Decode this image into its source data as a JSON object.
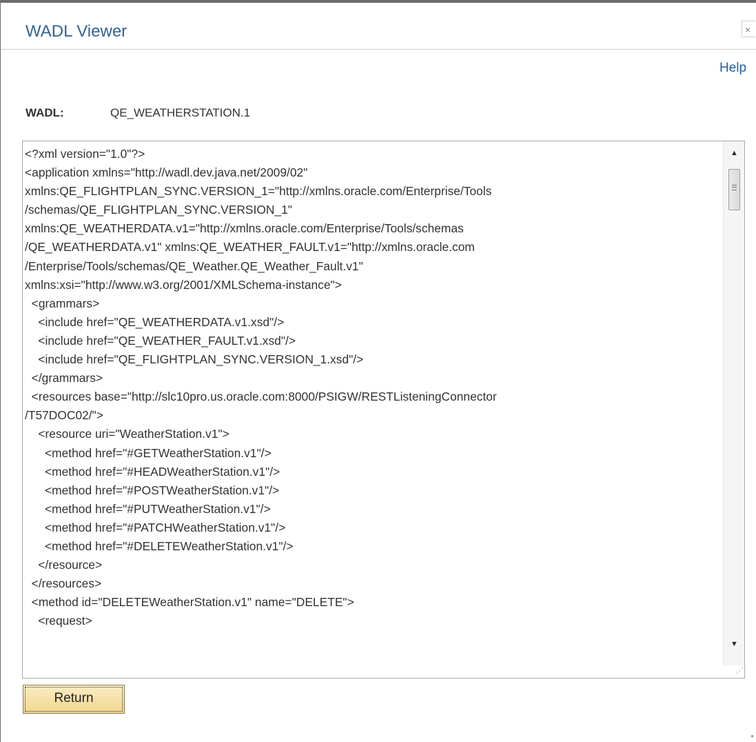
{
  "dialog": {
    "title": "WADL Viewer",
    "close_label": "×",
    "help_label": "Help"
  },
  "wadl": {
    "label": "WADL:",
    "value": "QE_WEATHERSTATION.1"
  },
  "content": {
    "text": "<?xml version=\"1.0\"?>\n<application xmlns=\"http://wadl.dev.java.net/2009/02\"\nxmlns:QE_FLIGHTPLAN_SYNC.VERSION_1=\"http://xmlns.oracle.com/Enterprise/Tools\n/schemas/QE_FLIGHTPLAN_SYNC.VERSION_1\"\nxmlns:QE_WEATHERDATA.v1=\"http://xmlns.oracle.com/Enterprise/Tools/schemas\n/QE_WEATHERDATA.v1\" xmlns:QE_WEATHER_FAULT.v1=\"http://xmlns.oracle.com\n/Enterprise/Tools/schemas/QE_Weather.QE_Weather_Fault.v1\"\nxmlns:xsi=\"http://www.w3.org/2001/XMLSchema-instance\">\n  <grammars>\n    <include href=\"QE_WEATHERDATA.v1.xsd\"/>\n    <include href=\"QE_WEATHER_FAULT.v1.xsd\"/>\n    <include href=\"QE_FLIGHTPLAN_SYNC.VERSION_1.xsd\"/>\n  </grammars>\n  <resources base=\"http://slc10pro.us.oracle.com:8000/PSIGW/RESTListeningConnector\n/T57DOC02/\">\n    <resource uri=\"WeatherStation.v1\">\n      <method href=\"#GETWeatherStation.v1\"/>\n      <method href=\"#HEADWeatherStation.v1\"/>\n      <method href=\"#POSTWeatherStation.v1\"/>\n      <method href=\"#PUTWeatherStation.v1\"/>\n      <method href=\"#PATCHWeatherStation.v1\"/>\n      <method href=\"#DELETEWeatherStation.v1\"/>\n    </resource>\n  </resources>\n  <method id=\"DELETEWeatherStation.v1\" name=\"DELETE\">\n    <request>"
  },
  "scrollbar": {
    "up_icon": "▲",
    "down_icon": "▼"
  },
  "resize_icon": "⋰",
  "footer": {
    "return_label": "Return"
  }
}
